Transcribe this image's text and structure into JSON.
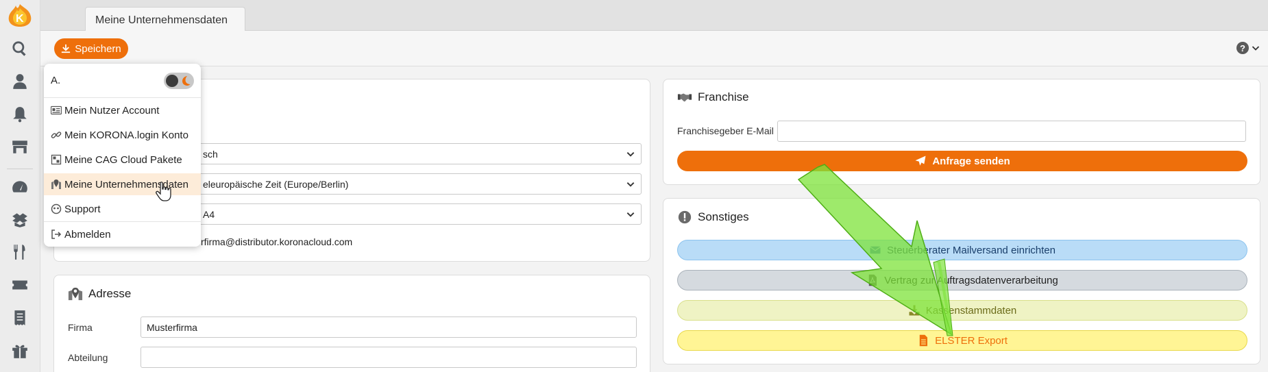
{
  "tab": {
    "label": "Meine Unternehmensdaten"
  },
  "toolbar": {
    "save_label": "Speichern"
  },
  "help": {
    "glyph": "?"
  },
  "left_panel": {
    "language_value": "sch",
    "timezone_value": "eleuropäische Zeit (Europe/Berlin)",
    "paper_value": "A4",
    "email_value": "rfirma@distributor.koronacloud.com"
  },
  "address": {
    "title": "Adresse",
    "firma_label": "Firma",
    "firma_value": "Musterfirma",
    "abteilung_label": "Abteilung",
    "abteilung_value": ""
  },
  "franchise": {
    "title": "Franchise",
    "email_label": "Franchisegeber E-Mail",
    "email_value": "",
    "send_label": "Anfrage senden"
  },
  "sonstiges": {
    "title": "Sonstiges",
    "buttons": [
      {
        "label": "Steuerberater Mailversand einrichten",
        "icon": "envelope-icon",
        "bg": "#b9dcf7",
        "border": "#8cc3ee",
        "color": "#1a3f6b"
      },
      {
        "label": "Vertrag zur Auftragsdatenverarbeitung",
        "icon": "pdf-icon",
        "bg": "#d5dadf",
        "border": "#aab2ba",
        "color": "#222"
      },
      {
        "label": "Kassenstammdaten",
        "icon": "download-icon",
        "bg": "#eff3c4",
        "border": "#d9e08a",
        "color": "#6b6b1a"
      },
      {
        "label": "ELSTER Export",
        "icon": "file-icon",
        "bg": "#fff595",
        "border": "#e8d84a",
        "color": "#ee6f0b"
      }
    ]
  },
  "menu": {
    "user": "A.",
    "items": [
      {
        "label": "Mein Nutzer Account"
      },
      {
        "label": "Mein KORONA.login Konto"
      },
      {
        "label": "Meine CAG Cloud Pakete"
      },
      {
        "label": "Meine Unternehmensdaten"
      },
      {
        "label": "Support"
      },
      {
        "label": "Abmelden"
      }
    ]
  },
  "colors": {
    "accent": "#ee6f0b",
    "arrow": "#7ee33a"
  }
}
